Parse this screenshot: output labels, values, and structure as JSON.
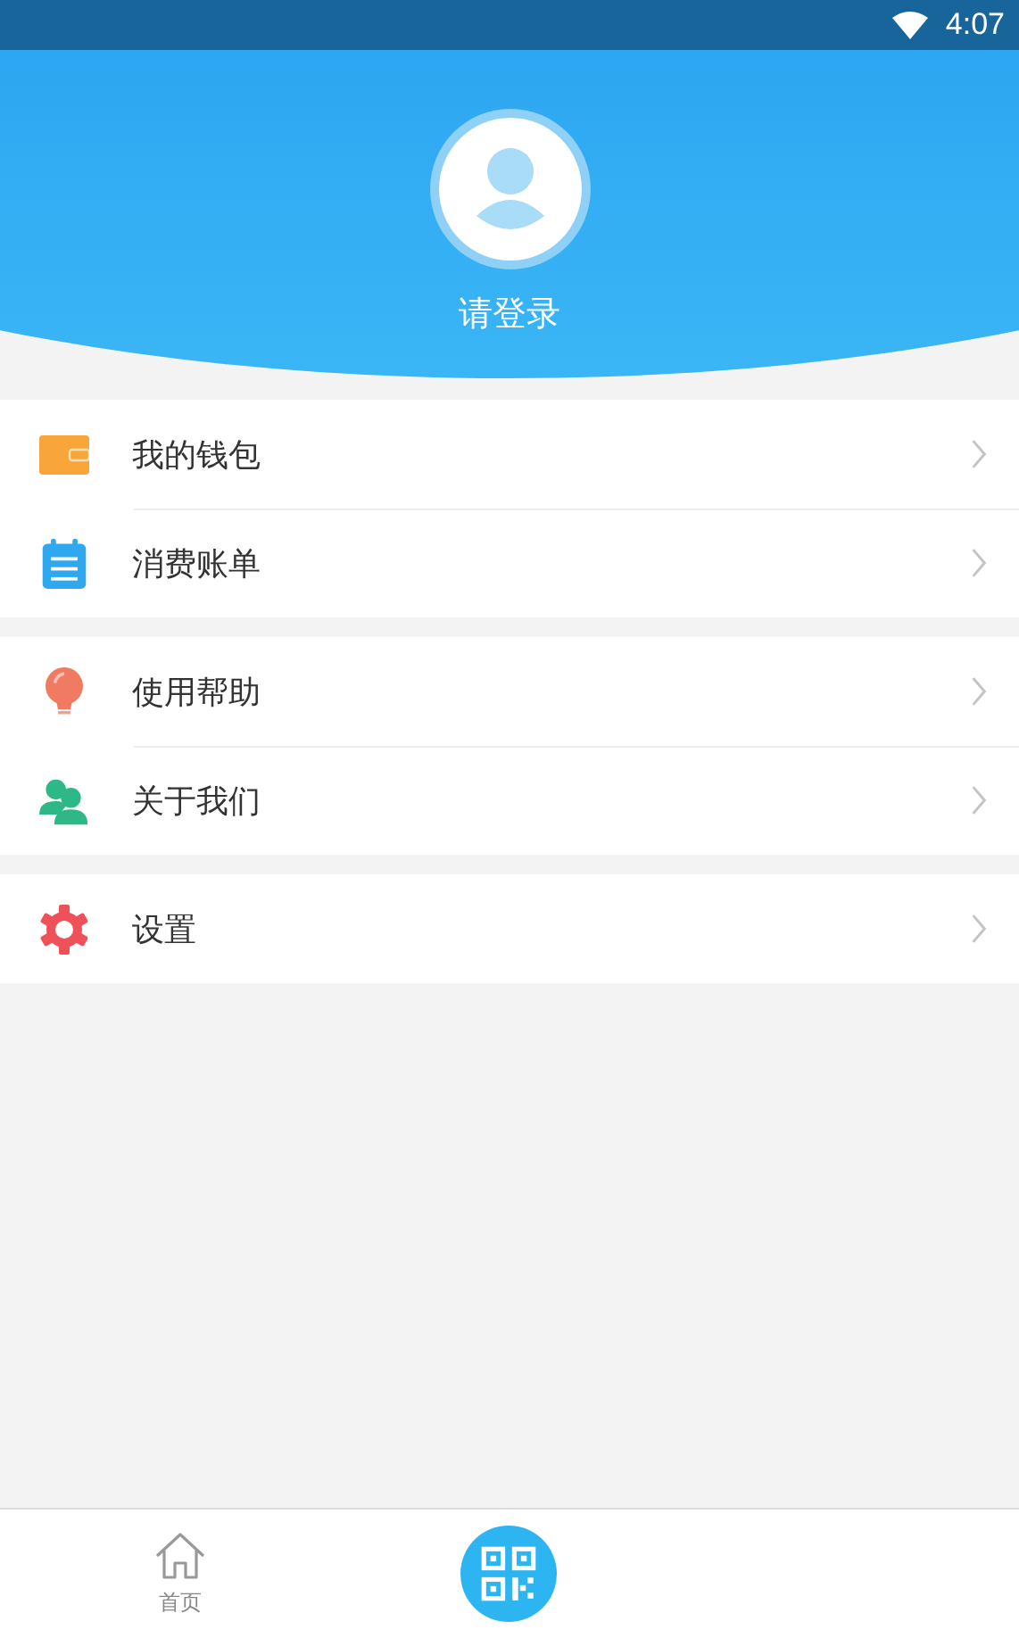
{
  "status_bar": {
    "time": "4:07"
  },
  "profile": {
    "login_label": "请登录"
  },
  "menu_groups": [
    [
      {
        "label": "我的钱包"
      },
      {
        "label": "消费账单"
      }
    ],
    [
      {
        "label": "使用帮助"
      },
      {
        "label": "关于我们"
      }
    ],
    [
      {
        "label": "设置"
      }
    ]
  ],
  "bottom_nav": {
    "home_label": "首页"
  }
}
